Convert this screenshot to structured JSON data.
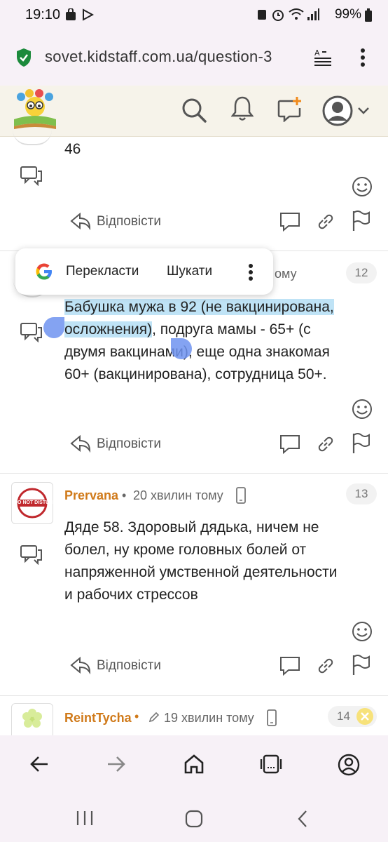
{
  "status_bar": {
    "time": "19:10",
    "battery": "99%"
  },
  "browser": {
    "url": "sovet.kidstaff.com.ua/question-3"
  },
  "comments": [
    {
      "visible_text": "46",
      "reply_label": "Відповісти"
    },
    {
      "meta_partial": "ому",
      "number": "12",
      "text_selected_1": "Бабушка мужа в 92 (не вакцинирована,",
      "text_selected_2": "осложнения)",
      "text_rest_2": ", подруга мамы - 65+ (с",
      "text_line_3a": "двумя вакцин",
      "text_line_3b": "ами",
      "text_line_3c": "), еще одна знакомая",
      "text_line_4": "60+ (вакцинирована), сотрудница 50+.",
      "reply_label": "Відповісти"
    },
    {
      "author": "Prervana",
      "time": "20 хвилин тому",
      "number": "13",
      "avatar_text": "DO NOT DISTURB",
      "text_line_1": "Дяде 58. Здоровый дядька, ничем не",
      "text_line_2": "болел, ну кроме головных болей от",
      "text_line_3": "напряженной умственной деятельности",
      "text_line_4": "и рабочих стрессов",
      "reply_label": "Відповісти"
    },
    {
      "author": "ReintTycha",
      "time": "19 хвилин тому",
      "number": "14"
    }
  ],
  "popup": {
    "translate": "Перекласти",
    "search": "Шукати"
  },
  "colors": {
    "author": "#d07a1a",
    "selection": "#bfe3f6",
    "handle": "#6f93f0"
  }
}
